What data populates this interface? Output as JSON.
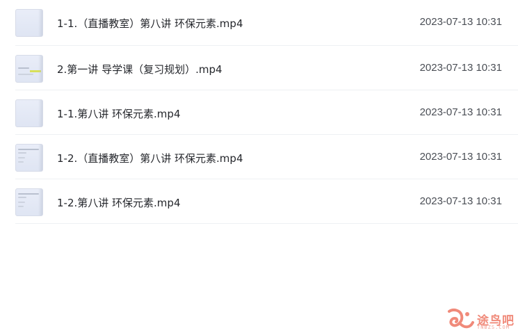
{
  "files": [
    {
      "name": "1-1.（直播教室）第八讲 环保元素.mp4",
      "date": "2023-07-13 10:31",
      "thumb": "blank"
    },
    {
      "name": "2.第一讲 导学课（复习规划）.mp4",
      "date": "2023-07-13 10:31",
      "thumb": "slide-highlight"
    },
    {
      "name": "1-1.第八讲 环保元素.mp4",
      "date": "2023-07-13 10:31",
      "thumb": "blank"
    },
    {
      "name": "1-2.（直播教室）第八讲 环保元素.mp4",
      "date": "2023-07-13 10:31",
      "thumb": "slide-text"
    },
    {
      "name": "1-2.第八讲 环保元素.mp4",
      "date": "2023-07-13 10:31",
      "thumb": "slide-text"
    }
  ],
  "watermark": {
    "text": "途鸟吧",
    "sub": "TNBZS.COM",
    "logo_icon": "bird-logo-icon",
    "color": "#f08a7a"
  }
}
